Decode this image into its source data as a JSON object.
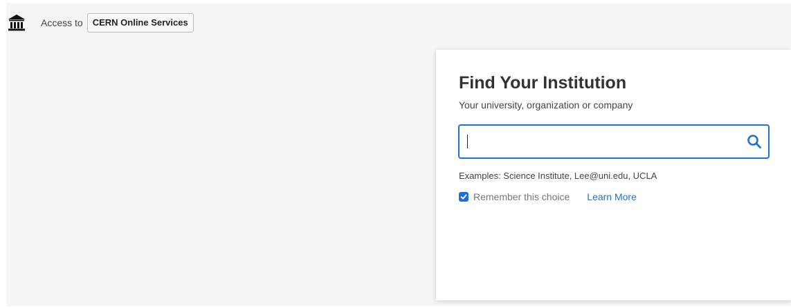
{
  "header": {
    "icon": "institution-icon",
    "access_label": "Access to",
    "service_name": "CERN Online Services"
  },
  "card": {
    "title": "Find Your Institution",
    "subtitle": "Your university, organization or company",
    "search": {
      "value": "",
      "placeholder": "",
      "icon": "search-icon"
    },
    "examples": "Examples: Science Institute, Lee@uni.edu, UCLA",
    "remember": {
      "label": "Remember this choice",
      "checked": true
    },
    "learn_more": "Learn More"
  },
  "colors": {
    "accent": "#1e6fd9",
    "background": "#f5f5f5",
    "card": "#ffffff"
  }
}
